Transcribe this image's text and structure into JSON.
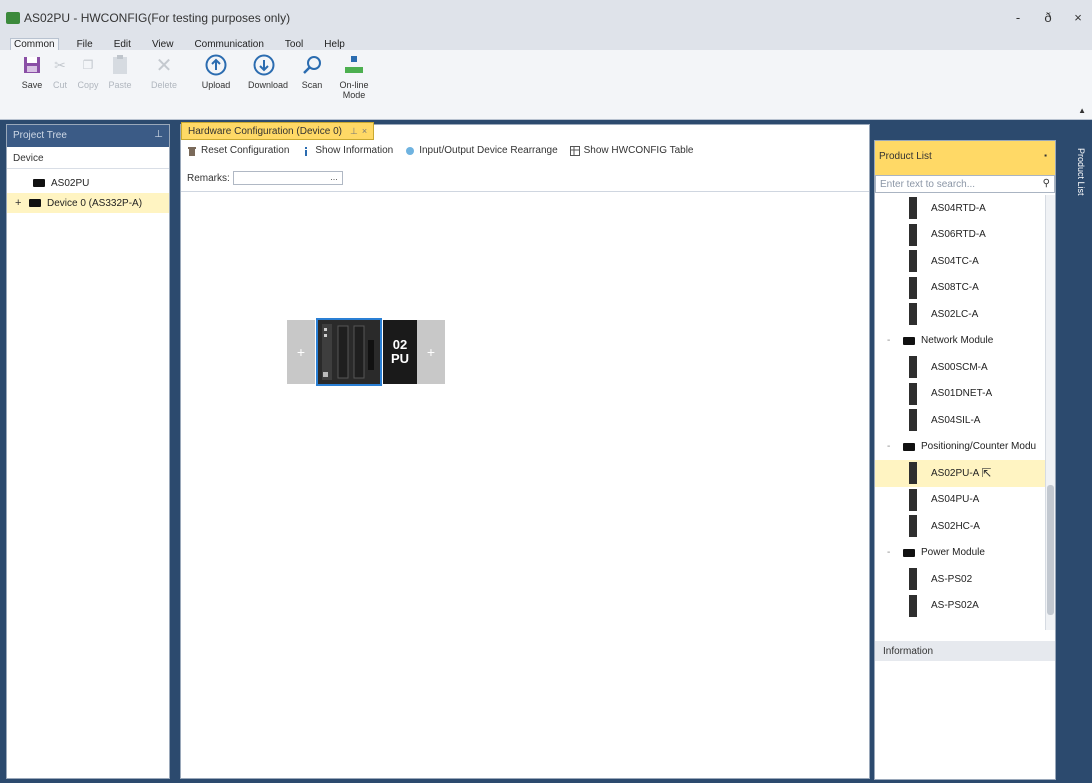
{
  "window": {
    "title": "AS02PU - HWCONFIG(For testing purposes only)",
    "controls": [
      "-",
      "ð",
      "×"
    ]
  },
  "menu": [
    "Common",
    "File",
    "Edit",
    "View",
    "Communication",
    "Tool",
    "Help"
  ],
  "ribbon": {
    "save": "Save",
    "cut": "Cut",
    "copy": "Copy",
    "paste": "Paste",
    "delete": "Delete",
    "upload": "Upload",
    "download": "Download",
    "scan": "Scan",
    "online_mode": "On-line Mode"
  },
  "project_tree": {
    "header": "Project Tree",
    "pin": "⊥",
    "sub_header": "Device",
    "items": [
      {
        "label": "AS02PU"
      },
      {
        "label": "Device 0 (AS332P-A)",
        "expander": "+"
      }
    ]
  },
  "document": {
    "tab": "Hardware Configuration (Device 0)",
    "toolbar": {
      "reset": "Reset Configuration",
      "show_info": "Show Information",
      "rearrange": "Input/Output Device Rearrange",
      "show_table": "Show HWCONFIG Table"
    },
    "remarks_label": "Remarks:",
    "remarks_value": "",
    "remarks_more": "...",
    "rack": {
      "add_left": "+",
      "add_right": "+",
      "module_label": "02\nPU"
    }
  },
  "product_list": {
    "header": "Product List",
    "search_placeholder": "Enter text to search...",
    "rows": [
      {
        "type": "item",
        "label": "AS04RTD-A"
      },
      {
        "type": "item",
        "label": "AS06RTD-A"
      },
      {
        "type": "item",
        "label": "AS04TC-A"
      },
      {
        "type": "item",
        "label": "AS08TC-A"
      },
      {
        "type": "item",
        "label": "AS02LC-A"
      },
      {
        "type": "category",
        "label": "Network Module"
      },
      {
        "type": "item",
        "label": "AS00SCM-A"
      },
      {
        "type": "item",
        "label": "AS01DNET-A"
      },
      {
        "type": "item",
        "label": "AS04SIL-A"
      },
      {
        "type": "category",
        "label": "Positioning/Counter Modu"
      },
      {
        "type": "item",
        "label": "AS02PU-A",
        "hover": true
      },
      {
        "type": "item",
        "label": "AS04PU-A"
      },
      {
        "type": "item",
        "label": "AS02HC-A"
      },
      {
        "type": "category",
        "label": "Power Module"
      },
      {
        "type": "item",
        "label": "AS-PS02"
      },
      {
        "type": "item",
        "label": "AS-PS02A"
      }
    ],
    "info_tab": "Information",
    "side_tab": "Product List"
  },
  "colors": {
    "frame": "#2c4a6e",
    "tab_active": "#ffd966",
    "selection": "#fff4c2",
    "cpu_border": "#2a7fd4"
  }
}
